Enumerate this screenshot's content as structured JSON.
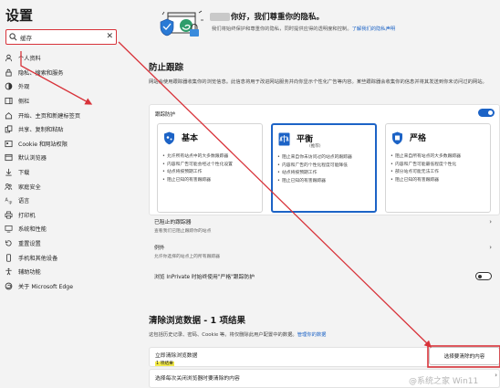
{
  "sidebar": {
    "title": "设置",
    "search": {
      "value": "缓存"
    },
    "items": [
      {
        "label": "个人资料",
        "icon": "profile-icon"
      },
      {
        "label": "隐私、搜索和服务",
        "icon": "lock-icon"
      },
      {
        "label": "外观",
        "icon": "appearance-icon"
      },
      {
        "label": "侧栏",
        "icon": "sidebar-icon"
      },
      {
        "label": "开始、主页和新建标签页",
        "icon": "home-icon"
      },
      {
        "label": "共享、复制和粘贴",
        "icon": "share-icon"
      },
      {
        "label": "Cookie 和网站权限",
        "icon": "cookie-icon"
      },
      {
        "label": "默认浏览器",
        "icon": "browser-icon"
      },
      {
        "label": "下载",
        "icon": "download-icon"
      },
      {
        "label": "家庭安全",
        "icon": "family-icon"
      },
      {
        "label": "语言",
        "icon": "language-icon"
      },
      {
        "label": "打印机",
        "icon": "printer-icon"
      },
      {
        "label": "系统和性能",
        "icon": "system-icon"
      },
      {
        "label": "重置设置",
        "icon": "reset-icon"
      },
      {
        "label": "手机和其他设备",
        "icon": "phone-icon"
      },
      {
        "label": "辅助功能",
        "icon": "accessibility-icon"
      },
      {
        "label": "关于 Microsoft Edge",
        "icon": "edge-icon"
      }
    ]
  },
  "hero": {
    "greeting": "你好，我们尊重你的隐私。",
    "desc": "我们将始终保护和尊重你的隐私，同时提供应得的透明度和控制。",
    "link": "了解我们的隐私声明"
  },
  "tracking": {
    "title": "防止跟踪",
    "desc": "网站会使用跟踪器收集你的浏览信息。此信息将用于改进网站服务并向你显示个性化广告等内容。某些跟踪器会收集你的信息并将其发送到你未访问过的网站。",
    "card_label": "跟踪防护",
    "levels": [
      {
        "name": "基本",
        "sub": "",
        "bullets": [
          "允许所有站点中的大多数跟踪器",
          "内容和广告可能会经过个性化设置",
          "站点将按预期工作",
          "阻止已知的有害跟踪器"
        ]
      },
      {
        "name": "平衡",
        "sub": "(推荐)",
        "bullets": [
          "阻止来自你未访问过的站点的跟踪器",
          "内容和广告的个性化程度可能降低",
          "站点将按预期工作",
          "阻止已知的有害跟踪器"
        ]
      },
      {
        "name": "严格",
        "sub": "",
        "bullets": [
          "阻止来自所有站点的大多数跟踪器",
          "内容和广告可能最低程度个性化",
          "部分站点可能无法工作",
          "阻止已知的有害跟踪器"
        ]
      }
    ],
    "blocked_title": "已阻止的跟踪器",
    "blocked_sub": "查看我们已阻止跟踪你的站点",
    "exceptions_title": "例外",
    "exceptions_sub": "允许你选择的站点上的所有跟踪器",
    "inprivate_label": "浏览 InPrivate 时始终使用\"严格\"跟踪防护"
  },
  "clear": {
    "title": "清除浏览数据 - 1 项结果",
    "desc": "这包括历史记录、密码、Cookie 等。将仅删除此用户配置中的数据。",
    "desc_link": "管理你的数据",
    "now_label": "立即清除浏览数据",
    "badge": "1 项结果",
    "choose_button": "选择要清除的内容",
    "on_close_label": "选择每次关闭浏览器时要清除的内容"
  },
  "watermark": "@系统之家 Win11",
  "colors": {
    "accent": "#1c63c6",
    "annotation_red": "#d8333a",
    "highlight": "#f5ec4a"
  }
}
